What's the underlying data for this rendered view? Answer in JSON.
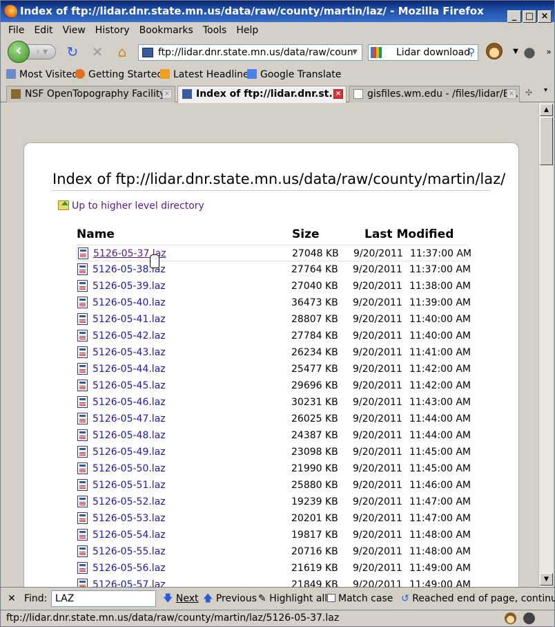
{
  "window": {
    "title": "Index of ftp://lidar.dnr.state.mn.us/data/raw/county/martin/laz/ - Mozilla Firefox"
  },
  "menu": [
    "File",
    "Edit",
    "View",
    "History",
    "Bookmarks",
    "Tools",
    "Help"
  ],
  "nav": {
    "url": "ftp://lidar.dnr.state.mn.us/data/raw/coun",
    "search": "Lidar download"
  },
  "bookmarks": [
    "Most Visited",
    "Getting Started",
    "Latest Headlines",
    "Google Translate"
  ],
  "tabs": [
    "NSF OpenTopography Facility",
    "Index of ftp://lidar.dnr.st...",
    "gisfiles.wm.edu - /files/lidar/ES..."
  ],
  "page": {
    "heading": "Index of ftp://lidar.dnr.state.mn.us/data/raw/county/martin/laz/",
    "up_link": "Up to higher level directory",
    "col_name": "Name",
    "col_size": "Size",
    "col_modified": "Last Modified",
    "files": [
      {
        "name": "5126-05-37.laz",
        "size": "27048 KB",
        "date": "9/20/2011",
        "time": "11:37:00 AM"
      },
      {
        "name": "5126-05-38.laz",
        "size": "27764 KB",
        "date": "9/20/2011",
        "time": "11:37:00 AM"
      },
      {
        "name": "5126-05-39.laz",
        "size": "27040 KB",
        "date": "9/20/2011",
        "time": "11:38:00 AM"
      },
      {
        "name": "5126-05-40.laz",
        "size": "36473 KB",
        "date": "9/20/2011",
        "time": "11:39:00 AM"
      },
      {
        "name": "5126-05-41.laz",
        "size": "28807 KB",
        "date": "9/20/2011",
        "time": "11:40:00 AM"
      },
      {
        "name": "5126-05-42.laz",
        "size": "27784 KB",
        "date": "9/20/2011",
        "time": "11:40:00 AM"
      },
      {
        "name": "5126-05-43.laz",
        "size": "26234 KB",
        "date": "9/20/2011",
        "time": "11:41:00 AM"
      },
      {
        "name": "5126-05-44.laz",
        "size": "25477 KB",
        "date": "9/20/2011",
        "time": "11:42:00 AM"
      },
      {
        "name": "5126-05-45.laz",
        "size": "29696 KB",
        "date": "9/20/2011",
        "time": "11:42:00 AM"
      },
      {
        "name": "5126-05-46.laz",
        "size": "30231 KB",
        "date": "9/20/2011",
        "time": "11:43:00 AM"
      },
      {
        "name": "5126-05-47.laz",
        "size": "26025 KB",
        "date": "9/20/2011",
        "time": "11:44:00 AM"
      },
      {
        "name": "5126-05-48.laz",
        "size": "24387 KB",
        "date": "9/20/2011",
        "time": "11:44:00 AM"
      },
      {
        "name": "5126-05-49.laz",
        "size": "23098 KB",
        "date": "9/20/2011",
        "time": "11:45:00 AM"
      },
      {
        "name": "5126-05-50.laz",
        "size": "21990 KB",
        "date": "9/20/2011",
        "time": "11:45:00 AM"
      },
      {
        "name": "5126-05-51.laz",
        "size": "25880 KB",
        "date": "9/20/2011",
        "time": "11:46:00 AM"
      },
      {
        "name": "5126-05-52.laz",
        "size": "19239 KB",
        "date": "9/20/2011",
        "time": "11:47:00 AM"
      },
      {
        "name": "5126-05-53.laz",
        "size": "20201 KB",
        "date": "9/20/2011",
        "time": "11:47:00 AM"
      },
      {
        "name": "5126-05-54.laz",
        "size": "19817 KB",
        "date": "9/20/2011",
        "time": "11:48:00 AM"
      },
      {
        "name": "5126-05-55.laz",
        "size": "20716 KB",
        "date": "9/20/2011",
        "time": "11:48:00 AM"
      },
      {
        "name": "5126-05-56.laz",
        "size": "21619 KB",
        "date": "9/20/2011",
        "time": "11:49:00 AM"
      },
      {
        "name": "5126-05-57.laz",
        "size": "21849 KB",
        "date": "9/20/2011",
        "time": "11:49:00 AM"
      }
    ]
  },
  "find": {
    "label": "Find:",
    "value": "LAZ",
    "next": "Next",
    "previous": "Previous",
    "highlight": "Highlight all",
    "match_case": "Match case",
    "status": "Reached end of page, continued"
  },
  "status": {
    "text": "ftp://lidar.dnr.state.mn.us/data/raw/county/martin/laz/5126-05-37.laz"
  }
}
